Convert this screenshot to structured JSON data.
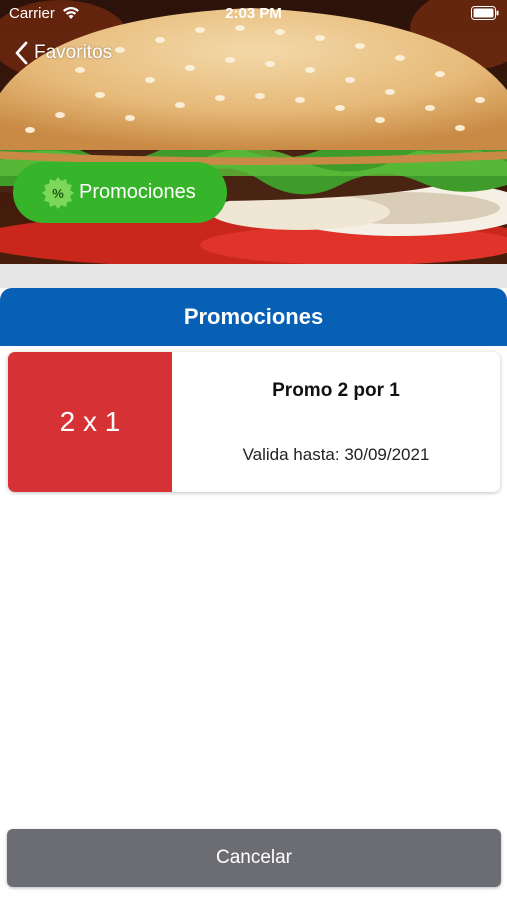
{
  "status_bar": {
    "carrier": "Carrier",
    "time": "2:03 PM",
    "wifi_icon": "wifi-icon",
    "battery_icon": "battery-icon"
  },
  "nav": {
    "back_label": "Favoritos",
    "back_icon": "chevron-left-icon"
  },
  "header_image": {
    "subject": "burger-photo"
  },
  "promo_pill": {
    "label": "Promociones",
    "icon": "percent-badge-icon",
    "color": "#37b52a"
  },
  "section": {
    "title": "Promociones",
    "color": "#0760b4"
  },
  "promotions": [
    {
      "badge": "2 x 1",
      "badge_color": "#d63235",
      "title": "Promo 2 por 1",
      "valid_until": "Valida hasta: 30/09/2021"
    }
  ],
  "footer": {
    "cancel_label": "Cancelar",
    "cancel_color": "#6c6d72"
  }
}
